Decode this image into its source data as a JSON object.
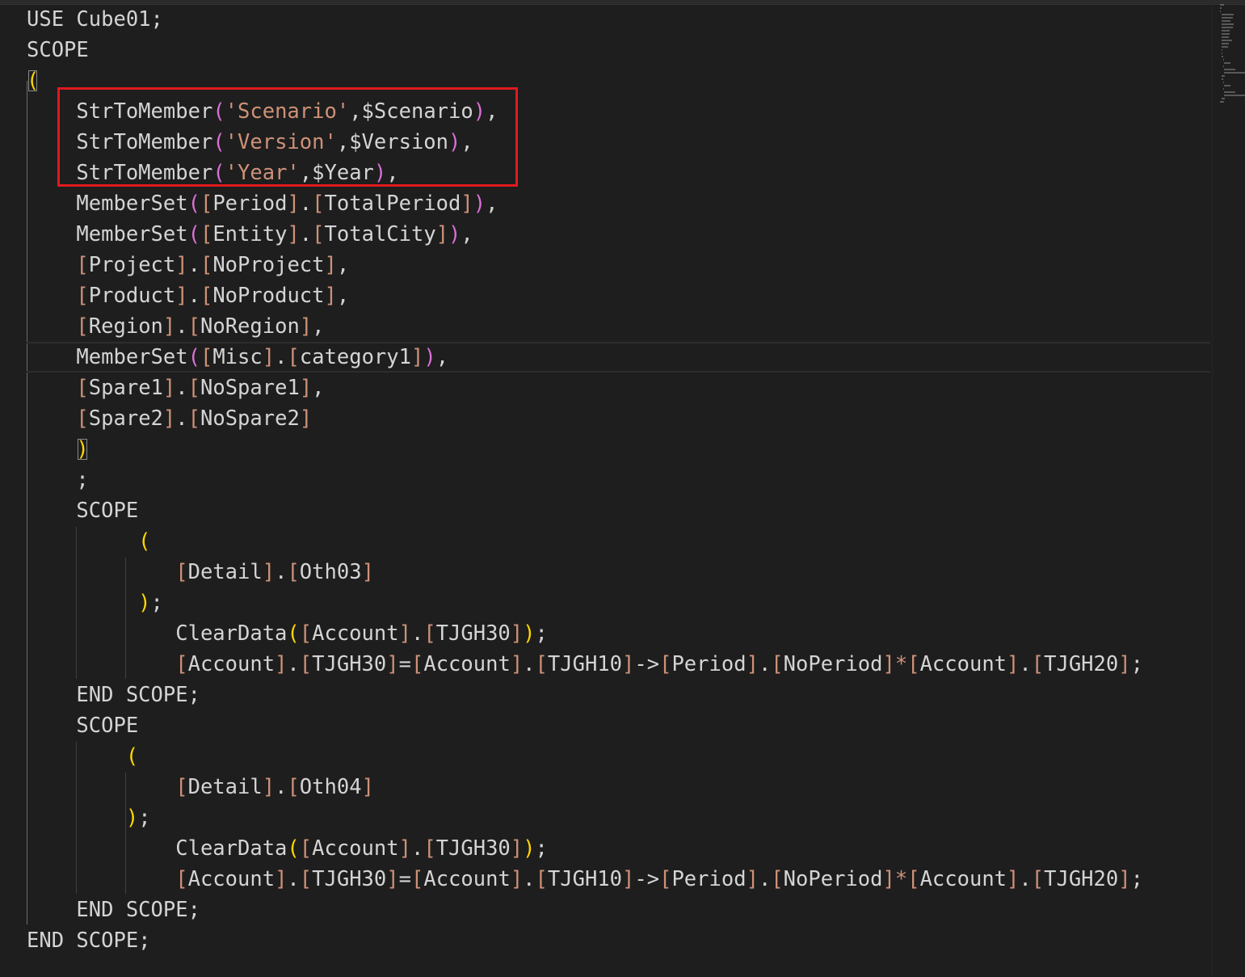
{
  "editor": {
    "language": "MDX script",
    "highlight_color": "#e0191e",
    "background": "#1e1e1e",
    "colors": {
      "text": "#d4d4d4",
      "bracket_gold": "#ffd700",
      "bracket_orchid": "#da70d6",
      "brace_blue": "#179fff",
      "member_bracket": "#ce9178",
      "string": "#ce9178",
      "operator": "#d4d4d4"
    }
  },
  "code_lines": [
    {
      "tokens": [
        {
          "t": "USE Cube01;",
          "c": "text"
        }
      ]
    },
    {
      "tokens": [
        {
          "t": "SCOPE",
          "c": "text"
        }
      ]
    },
    {
      "tokens": [
        {
          "t": "(",
          "c": "paren-gold-box"
        }
      ]
    },
    {
      "tokens": [
        {
          "t": "    ",
          "c": "text"
        },
        {
          "t": "StrToMember",
          "c": "text"
        },
        {
          "t": "(",
          "c": "paren-orchid"
        },
        {
          "t": "'Scenario'",
          "c": "string"
        },
        {
          "t": ",$Scenario",
          "c": "text"
        },
        {
          "t": ")",
          "c": "paren-orchid"
        },
        {
          "t": ",",
          "c": "text"
        }
      ]
    },
    {
      "tokens": [
        {
          "t": "    ",
          "c": "text"
        },
        {
          "t": "StrToMember",
          "c": "text"
        },
        {
          "t": "(",
          "c": "paren-orchid"
        },
        {
          "t": "'Version'",
          "c": "string"
        },
        {
          "t": ",$Version",
          "c": "text"
        },
        {
          "t": ")",
          "c": "paren-orchid"
        },
        {
          "t": ",",
          "c": "text"
        }
      ]
    },
    {
      "tokens": [
        {
          "t": "    ",
          "c": "text"
        },
        {
          "t": "StrToMember",
          "c": "text"
        },
        {
          "t": "(",
          "c": "paren-orchid"
        },
        {
          "t": "'Year'",
          "c": "string"
        },
        {
          "t": ",$Year",
          "c": "text"
        },
        {
          "t": ")",
          "c": "paren-orchid"
        },
        {
          "t": ",",
          "c": "text"
        }
      ]
    },
    {
      "tokens": [
        {
          "t": "    ",
          "c": "text"
        },
        {
          "t": "MemberSet",
          "c": "text"
        },
        {
          "t": "(",
          "c": "paren-orchid"
        },
        {
          "t": "[",
          "c": "mb"
        },
        {
          "t": "Period",
          "c": "text"
        },
        {
          "t": "]",
          "c": "mb"
        },
        {
          "t": ".",
          "c": "text"
        },
        {
          "t": "[",
          "c": "mb"
        },
        {
          "t": "TotalPeriod",
          "c": "text"
        },
        {
          "t": "]",
          "c": "mb"
        },
        {
          "t": ")",
          "c": "paren-orchid"
        },
        {
          "t": ",",
          "c": "text"
        }
      ]
    },
    {
      "tokens": [
        {
          "t": "    ",
          "c": "text"
        },
        {
          "t": "MemberSet",
          "c": "text"
        },
        {
          "t": "(",
          "c": "paren-orchid"
        },
        {
          "t": "[",
          "c": "mb"
        },
        {
          "t": "Entity",
          "c": "text"
        },
        {
          "t": "]",
          "c": "mb"
        },
        {
          "t": ".",
          "c": "text"
        },
        {
          "t": "[",
          "c": "mb"
        },
        {
          "t": "TotalCity",
          "c": "text"
        },
        {
          "t": "]",
          "c": "mb"
        },
        {
          "t": ")",
          "c": "paren-orchid"
        },
        {
          "t": ",",
          "c": "text"
        }
      ]
    },
    {
      "tokens": [
        {
          "t": "    ",
          "c": "text"
        },
        {
          "t": "[",
          "c": "mb"
        },
        {
          "t": "Project",
          "c": "text"
        },
        {
          "t": "]",
          "c": "mb"
        },
        {
          "t": ".",
          "c": "text"
        },
        {
          "t": "[",
          "c": "mb"
        },
        {
          "t": "NoProject",
          "c": "text"
        },
        {
          "t": "]",
          "c": "mb"
        },
        {
          "t": ",",
          "c": "text"
        }
      ]
    },
    {
      "tokens": [
        {
          "t": "    ",
          "c": "text"
        },
        {
          "t": "[",
          "c": "mb"
        },
        {
          "t": "Product",
          "c": "text"
        },
        {
          "t": "]",
          "c": "mb"
        },
        {
          "t": ".",
          "c": "text"
        },
        {
          "t": "[",
          "c": "mb"
        },
        {
          "t": "NoProduct",
          "c": "text"
        },
        {
          "t": "]",
          "c": "mb"
        },
        {
          "t": ",",
          "c": "text"
        }
      ]
    },
    {
      "tokens": [
        {
          "t": "    ",
          "c": "text"
        },
        {
          "t": "[",
          "c": "mb"
        },
        {
          "t": "Region",
          "c": "text"
        },
        {
          "t": "]",
          "c": "mb"
        },
        {
          "t": ".",
          "c": "text"
        },
        {
          "t": "[",
          "c": "mb"
        },
        {
          "t": "NoRegion",
          "c": "text"
        },
        {
          "t": "]",
          "c": "mb"
        },
        {
          "t": ",",
          "c": "text"
        }
      ]
    },
    {
      "tokens": [
        {
          "t": "    ",
          "c": "text"
        },
        {
          "t": "MemberSet",
          "c": "text"
        },
        {
          "t": "(",
          "c": "paren-orchid"
        },
        {
          "t": "[",
          "c": "mb"
        },
        {
          "t": "Misc",
          "c": "text"
        },
        {
          "t": "]",
          "c": "mb"
        },
        {
          "t": ".",
          "c": "text"
        },
        {
          "t": "[",
          "c": "mb"
        },
        {
          "t": "category1",
          "c": "text"
        },
        {
          "t": "]",
          "c": "mb"
        },
        {
          "t": ")",
          "c": "paren-orchid"
        },
        {
          "t": ",",
          "c": "text"
        }
      ]
    },
    {
      "tokens": [
        {
          "t": "    ",
          "c": "text"
        },
        {
          "t": "[",
          "c": "mb"
        },
        {
          "t": "Spare1",
          "c": "text"
        },
        {
          "t": "]",
          "c": "mb"
        },
        {
          "t": ".",
          "c": "text"
        },
        {
          "t": "[",
          "c": "mb"
        },
        {
          "t": "NoSpare1",
          "c": "text"
        },
        {
          "t": "]",
          "c": "mb"
        },
        {
          "t": ",",
          "c": "text"
        }
      ]
    },
    {
      "tokens": [
        {
          "t": "    ",
          "c": "text"
        },
        {
          "t": "[",
          "c": "mb"
        },
        {
          "t": "Spare2",
          "c": "text"
        },
        {
          "t": "]",
          "c": "mb"
        },
        {
          "t": ".",
          "c": "text"
        },
        {
          "t": "[",
          "c": "mb"
        },
        {
          "t": "NoSpare2",
          "c": "text"
        },
        {
          "t": "]",
          "c": "mb"
        }
      ]
    },
    {
      "tokens": [
        {
          "t": "    ",
          "c": "text"
        },
        {
          "t": ")",
          "c": "paren-gold-box"
        }
      ]
    },
    {
      "tokens": [
        {
          "t": "    ;",
          "c": "text"
        }
      ]
    },
    {
      "tokens": [
        {
          "t": "    SCOPE",
          "c": "text"
        }
      ]
    },
    {
      "tokens": [
        {
          "t": "         ",
          "c": "text"
        },
        {
          "t": "(",
          "c": "paren-gold"
        }
      ]
    },
    {
      "tokens": [
        {
          "t": "            ",
          "c": "text"
        },
        {
          "t": "[",
          "c": "mb"
        },
        {
          "t": "Detail",
          "c": "text"
        },
        {
          "t": "]",
          "c": "mb"
        },
        {
          "t": ".",
          "c": "text"
        },
        {
          "t": "[",
          "c": "mb"
        },
        {
          "t": "Oth03",
          "c": "text"
        },
        {
          "t": "]",
          "c": "mb"
        }
      ]
    },
    {
      "tokens": [
        {
          "t": "         ",
          "c": "text"
        },
        {
          "t": ")",
          "c": "paren-gold"
        },
        {
          "t": ";",
          "c": "text"
        }
      ]
    },
    {
      "tokens": [
        {
          "t": "            ",
          "c": "text"
        },
        {
          "t": "ClearData",
          "c": "text"
        },
        {
          "t": "(",
          "c": "paren-gold"
        },
        {
          "t": "[",
          "c": "mb"
        },
        {
          "t": "Account",
          "c": "text"
        },
        {
          "t": "]",
          "c": "mb"
        },
        {
          "t": ".",
          "c": "text"
        },
        {
          "t": "[",
          "c": "mb"
        },
        {
          "t": "TJGH30",
          "c": "text"
        },
        {
          "t": "]",
          "c": "mb"
        },
        {
          "t": ")",
          "c": "paren-gold"
        },
        {
          "t": ";",
          "c": "text"
        }
      ]
    },
    {
      "tokens": [
        {
          "t": "            ",
          "c": "text"
        },
        {
          "t": "[",
          "c": "mb"
        },
        {
          "t": "Account",
          "c": "text"
        },
        {
          "t": "]",
          "c": "mb"
        },
        {
          "t": ".",
          "c": "text"
        },
        {
          "t": "[",
          "c": "mb"
        },
        {
          "t": "TJGH30",
          "c": "text"
        },
        {
          "t": "]",
          "c": "mb"
        },
        {
          "t": "=",
          "c": "text"
        },
        {
          "t": "[",
          "c": "mb"
        },
        {
          "t": "Account",
          "c": "text"
        },
        {
          "t": "]",
          "c": "mb"
        },
        {
          "t": ".",
          "c": "text"
        },
        {
          "t": "[",
          "c": "mb"
        },
        {
          "t": "TJGH10",
          "c": "text"
        },
        {
          "t": "]",
          "c": "mb"
        },
        {
          "t": "->",
          "c": "text"
        },
        {
          "t": "[",
          "c": "mb"
        },
        {
          "t": "Period",
          "c": "text"
        },
        {
          "t": "]",
          "c": "mb"
        },
        {
          "t": ".",
          "c": "text"
        },
        {
          "t": "[",
          "c": "mb"
        },
        {
          "t": "NoPeriod",
          "c": "text"
        },
        {
          "t": "]",
          "c": "mb"
        },
        {
          "t": "*",
          "c": "mb"
        },
        {
          "t": "[",
          "c": "mb"
        },
        {
          "t": "Account",
          "c": "text"
        },
        {
          "t": "]",
          "c": "mb"
        },
        {
          "t": ".",
          "c": "text"
        },
        {
          "t": "[",
          "c": "mb"
        },
        {
          "t": "TJGH20",
          "c": "text"
        },
        {
          "t": "]",
          "c": "mb"
        },
        {
          "t": ";",
          "c": "text"
        }
      ]
    },
    {
      "tokens": [
        {
          "t": "    END SCOPE;",
          "c": "text"
        }
      ]
    },
    {
      "tokens": [
        {
          "t": "    SCOPE",
          "c": "text"
        }
      ]
    },
    {
      "tokens": [
        {
          "t": "        ",
          "c": "text"
        },
        {
          "t": "(",
          "c": "paren-gold"
        }
      ]
    },
    {
      "tokens": [
        {
          "t": "            ",
          "c": "text"
        },
        {
          "t": "[",
          "c": "mb"
        },
        {
          "t": "Detail",
          "c": "text"
        },
        {
          "t": "]",
          "c": "mb"
        },
        {
          "t": ".",
          "c": "text"
        },
        {
          "t": "[",
          "c": "mb"
        },
        {
          "t": "Oth04",
          "c": "text"
        },
        {
          "t": "]",
          "c": "mb"
        }
      ]
    },
    {
      "tokens": [
        {
          "t": "        ",
          "c": "text"
        },
        {
          "t": ")",
          "c": "paren-gold"
        },
        {
          "t": ";",
          "c": "text"
        }
      ]
    },
    {
      "tokens": [
        {
          "t": "            ",
          "c": "text"
        },
        {
          "t": "ClearData",
          "c": "text"
        },
        {
          "t": "(",
          "c": "paren-gold"
        },
        {
          "t": "[",
          "c": "mb"
        },
        {
          "t": "Account",
          "c": "text"
        },
        {
          "t": "]",
          "c": "mb"
        },
        {
          "t": ".",
          "c": "text"
        },
        {
          "t": "[",
          "c": "mb"
        },
        {
          "t": "TJGH30",
          "c": "text"
        },
        {
          "t": "]",
          "c": "mb"
        },
        {
          "t": ")",
          "c": "paren-gold"
        },
        {
          "t": ";",
          "c": "text"
        }
      ]
    },
    {
      "tokens": [
        {
          "t": "            ",
          "c": "text"
        },
        {
          "t": "[",
          "c": "mb"
        },
        {
          "t": "Account",
          "c": "text"
        },
        {
          "t": "]",
          "c": "mb"
        },
        {
          "t": ".",
          "c": "text"
        },
        {
          "t": "[",
          "c": "mb"
        },
        {
          "t": "TJGH30",
          "c": "text"
        },
        {
          "t": "]",
          "c": "mb"
        },
        {
          "t": "=",
          "c": "text"
        },
        {
          "t": "[",
          "c": "mb"
        },
        {
          "t": "Account",
          "c": "text"
        },
        {
          "t": "]",
          "c": "mb"
        },
        {
          "t": ".",
          "c": "text"
        },
        {
          "t": "[",
          "c": "mb"
        },
        {
          "t": "TJGH10",
          "c": "text"
        },
        {
          "t": "]",
          "c": "mb"
        },
        {
          "t": "->",
          "c": "text"
        },
        {
          "t": "[",
          "c": "mb"
        },
        {
          "t": "Period",
          "c": "text"
        },
        {
          "t": "]",
          "c": "mb"
        },
        {
          "t": ".",
          "c": "text"
        },
        {
          "t": "[",
          "c": "mb"
        },
        {
          "t": "NoPeriod",
          "c": "text"
        },
        {
          "t": "]",
          "c": "mb"
        },
        {
          "t": "*",
          "c": "mb"
        },
        {
          "t": "[",
          "c": "mb"
        },
        {
          "t": "Account",
          "c": "text"
        },
        {
          "t": "]",
          "c": "mb"
        },
        {
          "t": ".",
          "c": "text"
        },
        {
          "t": "[",
          "c": "mb"
        },
        {
          "t": "TJGH20",
          "c": "text"
        },
        {
          "t": "]",
          "c": "mb"
        },
        {
          "t": ";",
          "c": "text"
        }
      ]
    },
    {
      "tokens": [
        {
          "t": "    END SCOPE;",
          "c": "text"
        }
      ]
    },
    {
      "tokens": [
        {
          "t": "END SCOPE;",
          "c": "text"
        }
      ]
    }
  ]
}
